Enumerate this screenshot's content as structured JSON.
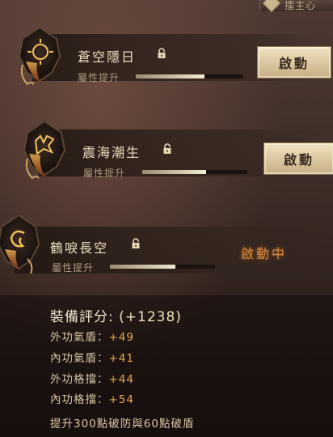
{
  "header": {
    "tab_label": "擂主心"
  },
  "skills": [
    {
      "name": "蒼空隱日",
      "attr_label": "屬性提升",
      "progress": 0.64,
      "action": "啟動",
      "icon": "sun-rune-icon"
    },
    {
      "name": "震海潮生",
      "attr_label": "屬性提升",
      "progress": 0.61,
      "action": "啟動",
      "icon": "dragon-rune-icon"
    },
    {
      "name": "鶴唳長空",
      "attr_label": "屬性提升",
      "progress": 0.62,
      "action": "啟動中",
      "icon": "crane-rune-icon"
    }
  ],
  "stats": {
    "score_label": "裝備評分:",
    "score_value": "(+1238)",
    "items": [
      {
        "label": "外功氣盾：",
        "value": "+49"
      },
      {
        "label": "內功氣盾：",
        "value": "+41"
      },
      {
        "label": "外功格擋：",
        "value": "+44"
      },
      {
        "label": "內功格擋：",
        "value": "+54"
      }
    ],
    "footer": "提升300點破防與60點破盾"
  },
  "colors": {
    "accent_orange": "#e9a94a",
    "active_orange": "#d88a3a",
    "button_gold": "#d7c39c"
  }
}
